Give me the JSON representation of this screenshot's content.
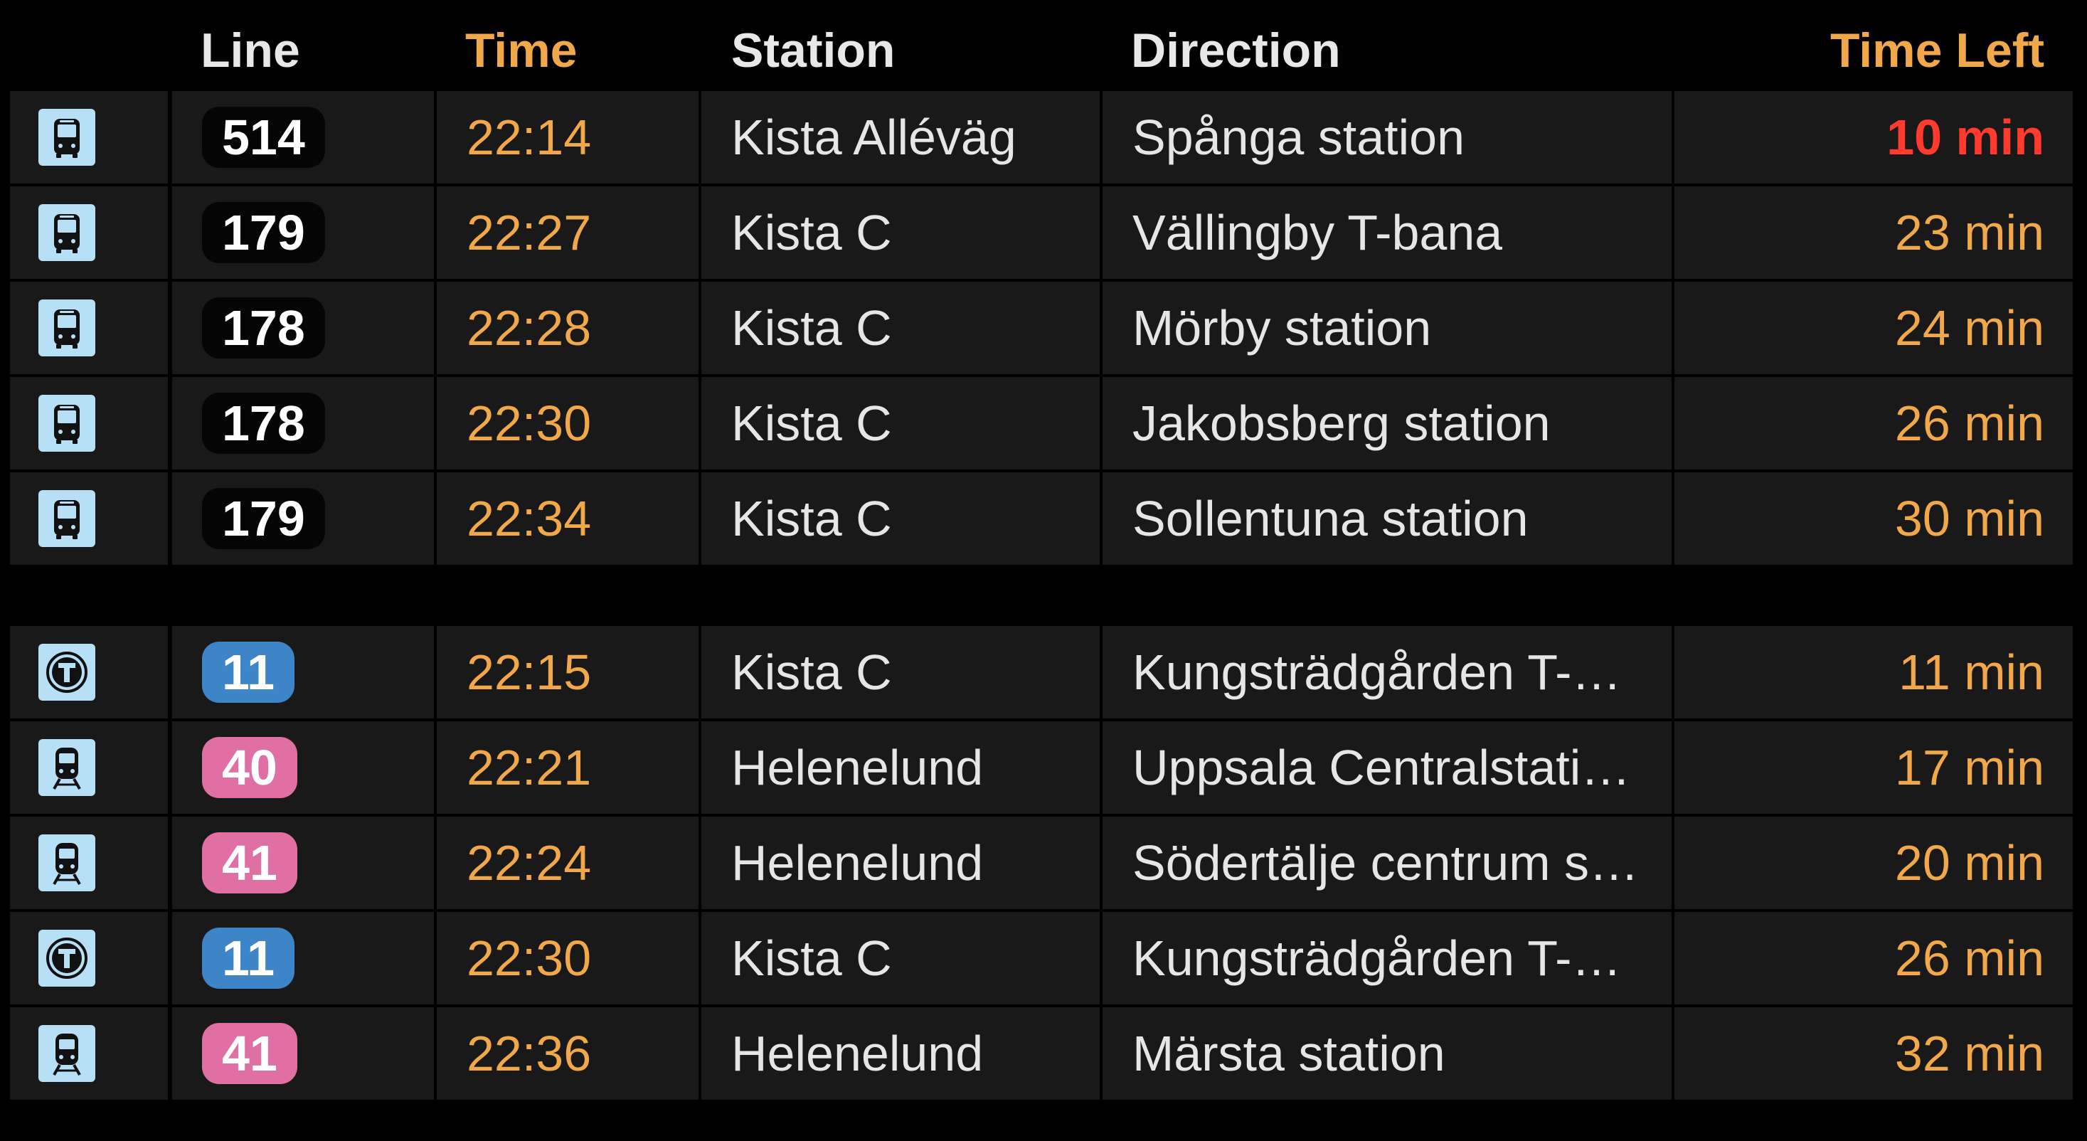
{
  "headers": {
    "line": "Line",
    "time": "Time",
    "station": "Station",
    "direction": "Direction",
    "time_left": "Time Left"
  },
  "colors": {
    "background": "#000000",
    "cell": "#191919",
    "orange": "#f0a84a",
    "urgent": "#ff3b30",
    "icon_bg": "#b7dff5",
    "metro_badge": "#3d85c6",
    "train_badge": "#e06fa4"
  },
  "bus_departures": [
    {
      "icon": "bus-icon",
      "line": "514",
      "time": "22:14",
      "station": "Kista Alléväg",
      "direction": "Spånga station",
      "time_left": "10 min",
      "urgent": true
    },
    {
      "icon": "bus-icon",
      "line": "179",
      "time": "22:27",
      "station": "Kista C",
      "direction": "Vällingby T-bana",
      "time_left": "23 min"
    },
    {
      "icon": "bus-icon",
      "line": "178",
      "time": "22:28",
      "station": "Kista C",
      "direction": "Mörby station",
      "time_left": "24 min"
    },
    {
      "icon": "bus-icon",
      "line": "178",
      "time": "22:30",
      "station": "Kista C",
      "direction": "Jakobsberg station",
      "time_left": "26 min"
    },
    {
      "icon": "bus-icon",
      "line": "179",
      "time": "22:34",
      "station": "Kista C",
      "direction": "Sollentuna station",
      "time_left": "30 min"
    }
  ],
  "rail_departures": [
    {
      "icon": "metro-icon",
      "line": "11",
      "time": "22:15",
      "station": "Kista C",
      "direction": "Kungsträdgården T-…",
      "time_left": "11 min"
    },
    {
      "icon": "train-icon",
      "line": "40",
      "time": "22:21",
      "station": "Helenelund",
      "direction": "Uppsala Centralstati…",
      "time_left": "17 min"
    },
    {
      "icon": "train-icon",
      "line": "41",
      "time": "22:24",
      "station": "Helenelund",
      "direction": "Södertälje centrum s…",
      "time_left": "20 min"
    },
    {
      "icon": "metro-icon",
      "line": "11",
      "time": "22:30",
      "station": "Kista C",
      "direction": "Kungsträdgården T-…",
      "time_left": "26 min"
    },
    {
      "icon": "train-icon",
      "line": "41",
      "time": "22:36",
      "station": "Helenelund",
      "direction": "Märsta station",
      "time_left": "32 min"
    }
  ]
}
